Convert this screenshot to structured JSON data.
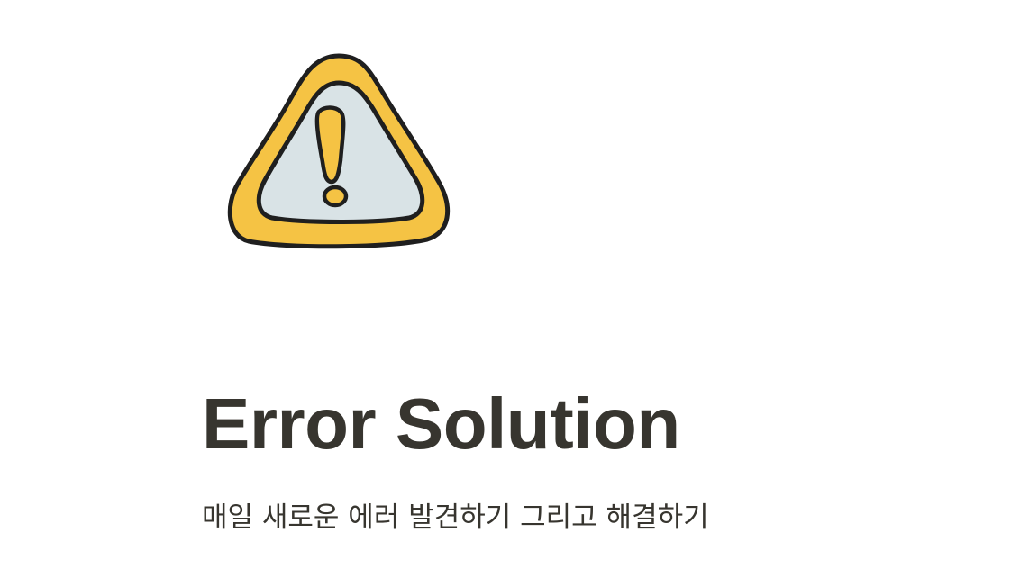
{
  "page": {
    "icon": "warning-icon",
    "title": "Error Solution",
    "description": "매일 새로운 에러 발견하기 그리고 해결하기"
  },
  "colors": {
    "icon_fill": "#f5c344",
    "icon_inner": "#d9e3e6",
    "icon_outline": "#1f1f1f",
    "text": "#37352f",
    "background": "#ffffff"
  }
}
